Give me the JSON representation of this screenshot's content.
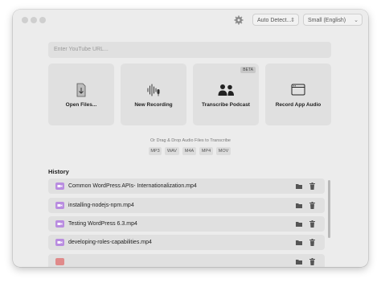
{
  "toolbar": {
    "language_select": "Auto Detect...",
    "model_select": "Small (English)"
  },
  "url_input": {
    "placeholder": "Enter YouTube URL..."
  },
  "actions": [
    {
      "label": "Open Files...",
      "icon": "file-import-icon"
    },
    {
      "label": "New Recording",
      "icon": "waveform-mic-icon"
    },
    {
      "label": "Transcribe Podcast",
      "icon": "people-icon",
      "badge": "BETA"
    },
    {
      "label": "Record App Audio",
      "icon": "app-window-icon"
    }
  ],
  "drop": {
    "hint": "Or Drag & Drop Audio Files to Transcribe",
    "formats": [
      "MP3",
      "WAV",
      "M4A",
      "MP4",
      "MOV"
    ]
  },
  "history": {
    "title": "History",
    "items": [
      "Common WordPress APIs- Internationalization.mp4",
      "installing-nodejs-npm.mp4",
      "Testing WordPress 6.3.mp4",
      "developing-roles-capabilities.mp4"
    ]
  },
  "colors": {
    "video_icon": "#b98ce0",
    "tile_bg": "#e0e0e0",
    "window_bg": "#ececec"
  }
}
